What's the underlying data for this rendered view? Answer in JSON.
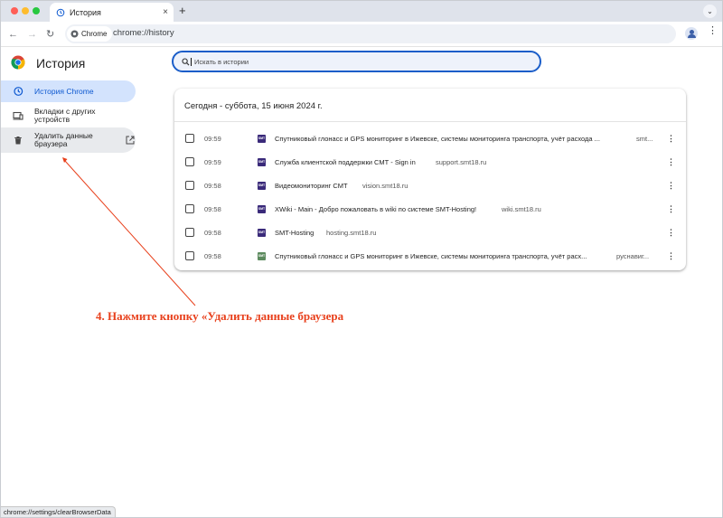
{
  "tab": {
    "title": "История",
    "close": "×",
    "icon": "history-icon"
  },
  "tabstrip": {
    "new_tab": "+",
    "tab_search": "⌄"
  },
  "toolbar": {
    "back": "←",
    "forward": "→",
    "reload": "↻",
    "chip_label": "Chrome",
    "url": "chrome://history",
    "bookmark": "☆",
    "menu": "⋮"
  },
  "sidebar": {
    "title": "История",
    "items": [
      {
        "label": "История Chrome",
        "icon": "history-icon",
        "active": true
      },
      {
        "label": "Вкладки с других устройств",
        "icon": "devices-icon"
      },
      {
        "label": "Удалить данные браузера",
        "icon": "trash-icon"
      }
    ]
  },
  "search": {
    "placeholder": "Искать в истории"
  },
  "history": {
    "heading": "Сегодня - суббота, 15 июня 2024 г.",
    "rows": [
      {
        "time": "09:59",
        "title": "Спутниковый глонасс и GPS мониторинг в Ижевске, системы мониторинга транспорта, учёт расхода ...",
        "domain": "smt...",
        "favicon": "SMT"
      },
      {
        "time": "09:59",
        "title": "Служба клиентской поддержки СМТ - Sign in",
        "domain": "support.smt18.ru",
        "favicon": "SMT"
      },
      {
        "time": "09:58",
        "title": "Видеомониторинг СМТ",
        "domain": "vision.smt18.ru",
        "favicon": "SMT"
      },
      {
        "time": "09:58",
        "title": "XWiki - Main - Добро пожаловать в wiki по системе SMT-Hosting!",
        "domain": "wiki.smt18.ru",
        "favicon": "SMT"
      },
      {
        "time": "09:58",
        "title": "SMT-Hosting",
        "domain": "hosting.smt18.ru",
        "favicon": "SMT"
      },
      {
        "time": "09:58",
        "title": "Спутниковый глонасс и GPS мониторинг в Ижевске, системы мониторинга транспорта, учёт расх...",
        "domain": "руснавиг...",
        "favicon": "SMT"
      }
    ],
    "kebab": "⋮"
  },
  "annotation": {
    "text": "4. Нажмите кнопку «Удалить данные браузера",
    "color": "#e8401c"
  },
  "status_bar": {
    "text": "chrome://settings/clearBrowserData"
  },
  "colors": {
    "accent": "#0b57d0",
    "active_bg": "#d3e3fd",
    "search_border": "#1a5dc9"
  }
}
